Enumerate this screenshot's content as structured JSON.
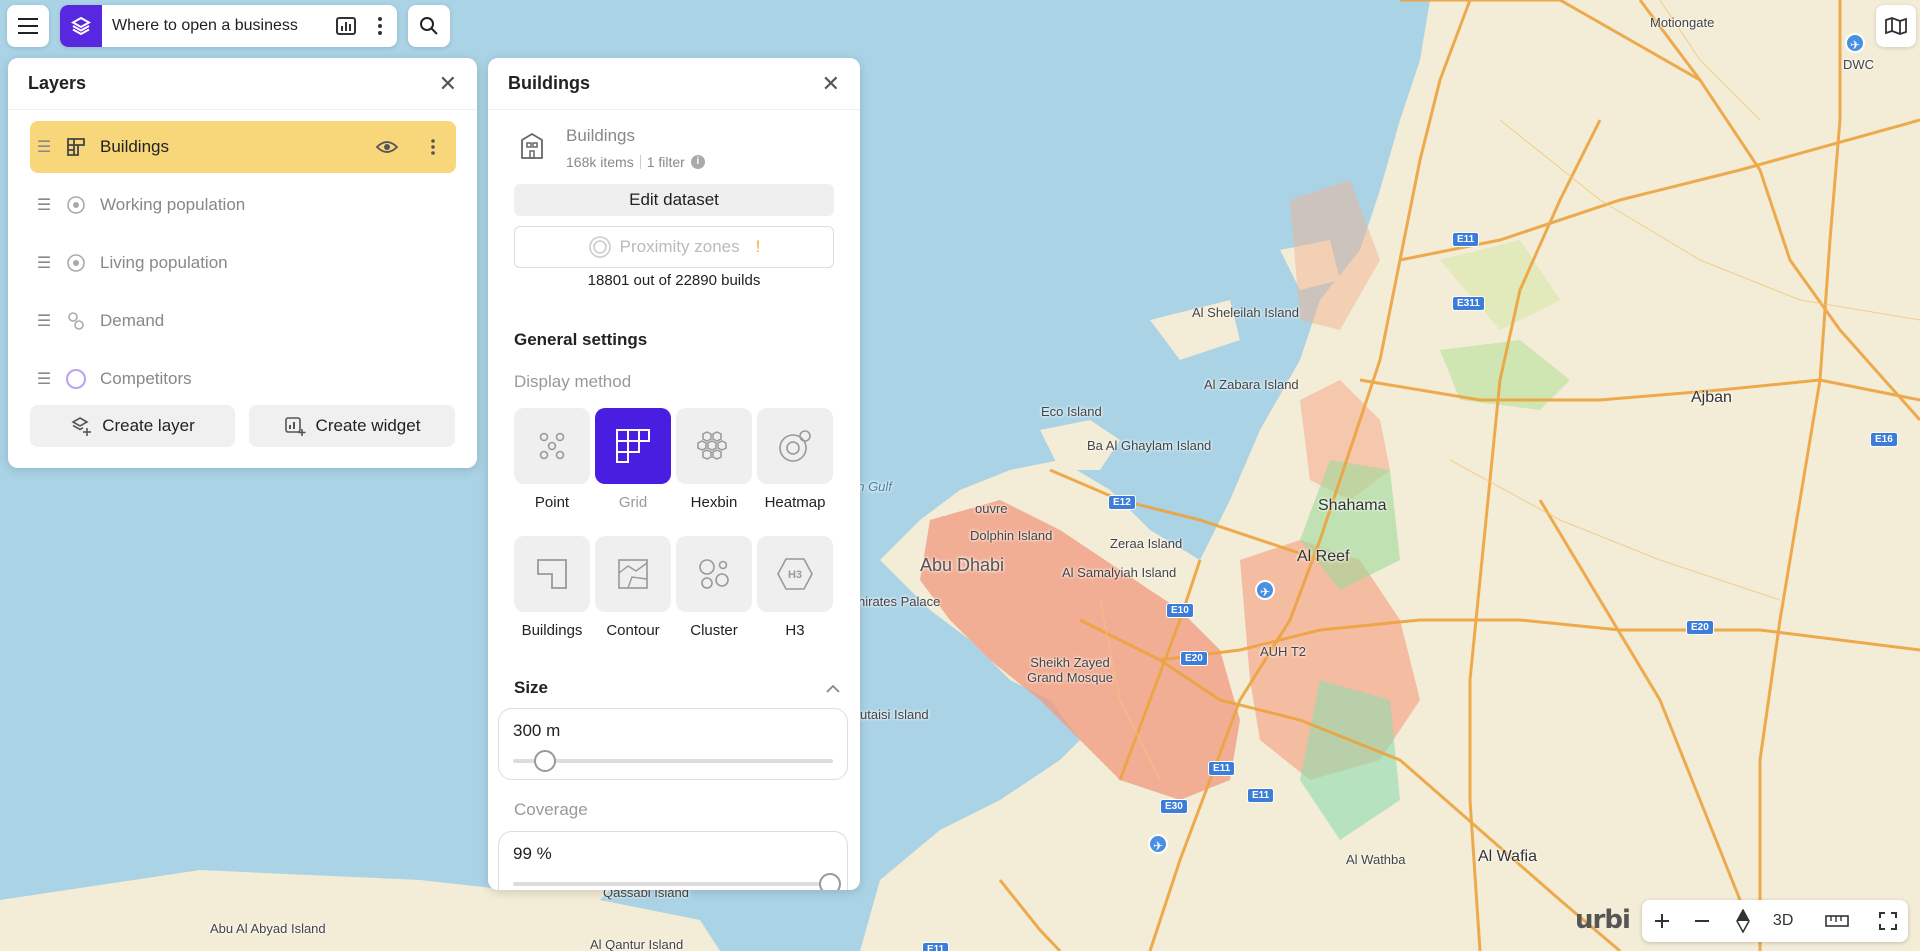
{
  "topbar": {
    "title": "Where to open a business"
  },
  "layers_panel": {
    "title": "Layers",
    "layers": [
      {
        "name": "Buildings",
        "active": true,
        "icon": "grid-icon"
      },
      {
        "name": "Working population",
        "active": false,
        "icon": "heatmap-icon"
      },
      {
        "name": "Living population",
        "active": false,
        "icon": "heatmap-icon"
      },
      {
        "name": "Demand",
        "active": false,
        "icon": "cluster-icon"
      },
      {
        "name": "Competitors",
        "active": false,
        "icon": "circle-icon"
      }
    ],
    "create_layer_label": "Create layer",
    "create_widget_label": "Create widget"
  },
  "buildings_panel": {
    "title": "Buildings",
    "dataset_name": "Buildings",
    "items_count": "168k items",
    "filters": "1 filter",
    "edit_dataset_label": "Edit dataset",
    "proximity_label": "Proximity zones",
    "proximity_warning": "!",
    "builds_count": "18801 out of 22890 builds",
    "general_settings_title": "General settings",
    "display_method_label": "Display method",
    "methods": [
      {
        "label": "Point",
        "selected": false
      },
      {
        "label": "Grid",
        "selected": true
      },
      {
        "label": "Hexbin",
        "selected": false
      },
      {
        "label": "Heatmap",
        "selected": false
      },
      {
        "label": "Buildings",
        "selected": false
      },
      {
        "label": "Contour",
        "selected": false
      },
      {
        "label": "Cluster",
        "selected": false
      },
      {
        "label": "H3",
        "selected": false
      }
    ],
    "size_title": "Size",
    "size_value": "300  m",
    "size_fraction": 0.1,
    "coverage_label": "Coverage",
    "coverage_value": "99  %",
    "coverage_fraction": 0.99
  },
  "map": {
    "labels": {
      "motiongate": "Motiongate",
      "dwc": "DWC",
      "al_sheleilah": "Al Sheleilah Island",
      "al_zabara": "Al Zabara Island",
      "eco_island": "Eco Island",
      "ba_al_ghaylam": "Ba Al Ghaylam Island",
      "gulf": "an Gulf",
      "shahama": "Shahama",
      "ajban": "Ajban",
      "dolphin": "Dolphin Island",
      "zeraa": "Zeraa Island",
      "abu_dhabi": "Abu Dhabi",
      "al_reef": "Al Reef",
      "al_samalyiah": "Al Samalyiah Island",
      "emirates_palace": "nirates Palace",
      "louvre": "ouvre",
      "mosque": "Sheikh Zayed Grand Mosque",
      "auh": "AUH T2",
      "utaisi": "utaisi Island",
      "al_wathba": "Al Wathba",
      "al_wafia": "Al Wafia",
      "qassabi": "Qassabi Island",
      "abu_al_abyad": "Abu Al Abyad Island",
      "al_qantur": "Al Qantur Island"
    },
    "shields": [
      "E11",
      "E311",
      "E12",
      "E16",
      "E10",
      "E20",
      "E20",
      "E11",
      "E30",
      "E11",
      "E11"
    ],
    "brand": "urbi"
  },
  "controls": {
    "three_d": "3D"
  },
  "colors": {
    "accent": "#5728e0",
    "active_layer": "#f7d77a",
    "water": "#aad3e6",
    "land": "#f3ecd6",
    "road": "#eda33e"
  }
}
